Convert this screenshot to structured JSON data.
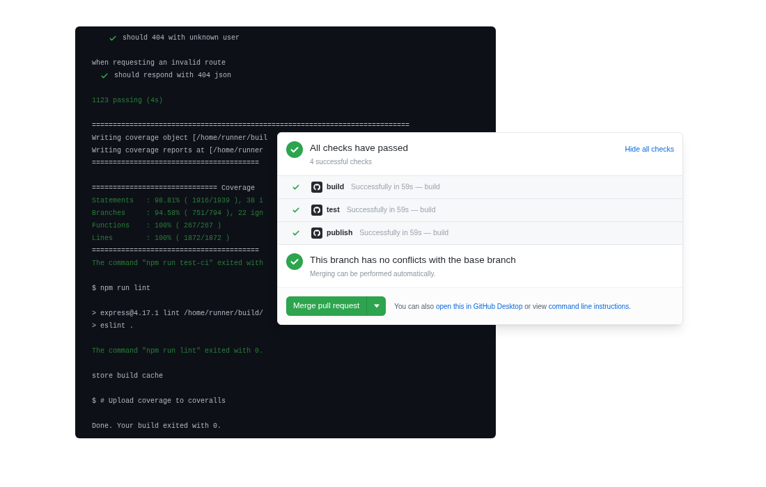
{
  "terminal": {
    "blocks": [
      {
        "lines": [
          {
            "kind": "check-deep",
            "text": "should 404 with unknown user"
          }
        ]
      },
      {
        "lines": [
          {
            "kind": "plain",
            "text": "when requesting an invalid route"
          },
          {
            "kind": "check",
            "text": "should respond with 404 json"
          }
        ]
      },
      {
        "lines": [
          {
            "kind": "success",
            "text": "1123 passing (4s)"
          }
        ]
      },
      {
        "lines": [
          {
            "kind": "plain",
            "text": "============================================================================"
          },
          {
            "kind": "plain",
            "text": "Writing coverage object [/home/runner/buil"
          },
          {
            "kind": "plain",
            "text": "Writing coverage reports at [/home/runner"
          },
          {
            "kind": "plain",
            "text": "========================================"
          }
        ]
      },
      {
        "lines": [
          {
            "kind": "plain",
            "text": "============================== Coverage"
          },
          {
            "kind": "success",
            "text": "Statements   : 98.81% ( 1916/1939 ), 38 i"
          },
          {
            "kind": "success",
            "text": "Branches     : 94.58% ( 751/794 ), 22 ign"
          },
          {
            "kind": "success",
            "text": "Functions    : 100% ( 267/267 )"
          },
          {
            "kind": "success",
            "text": "Lines        : 100% ( 1872/1872 )"
          },
          {
            "kind": "plain",
            "text": "========================================"
          },
          {
            "kind": "success",
            "text": "The command \"npm run test-ci\" exited with"
          }
        ]
      },
      {
        "lines": [
          {
            "kind": "plain",
            "text": "$ npm run lint"
          }
        ]
      },
      {
        "lines": [
          {
            "kind": "plain",
            "text": "> express@4.17.1 lint /home/runner/build/"
          },
          {
            "kind": "plain",
            "text": "> eslint ."
          }
        ]
      },
      {
        "lines": [
          {
            "kind": "success",
            "text": "The command \"npm run lint\" exited with 0."
          }
        ]
      },
      {
        "lines": [
          {
            "kind": "plain",
            "text": "store build cache"
          }
        ]
      },
      {
        "lines": [
          {
            "kind": "plain",
            "text": "$ # Upload coverage to coveralls"
          }
        ]
      },
      {
        "lines": [
          {
            "kind": "plain",
            "text": "Done. Your build exited with 0."
          }
        ]
      }
    ]
  },
  "checks_card": {
    "title": "All checks have passed",
    "subtitle": "4 successful checks",
    "toggle_link": "Hide all checks",
    "checks": [
      {
        "name": "build",
        "status": "Successfully in 59s — build",
        "passed": true
      },
      {
        "name": "test",
        "status": "Successfully in 59s — build",
        "passed": true
      },
      {
        "name": "publish",
        "status": "Successfully in 59s — build",
        "passed": true
      }
    ],
    "merge_status": {
      "title": "This branch has no conflicts with the base branch",
      "subtitle": "Merging can be performed automatically."
    },
    "merge_button": "Merge pull request",
    "footer": {
      "prefix": "You can also",
      "link_1": "open this in GitHub Desktop",
      "middle": "or view",
      "link_2": "command line instructions",
      "suffix": "."
    }
  }
}
